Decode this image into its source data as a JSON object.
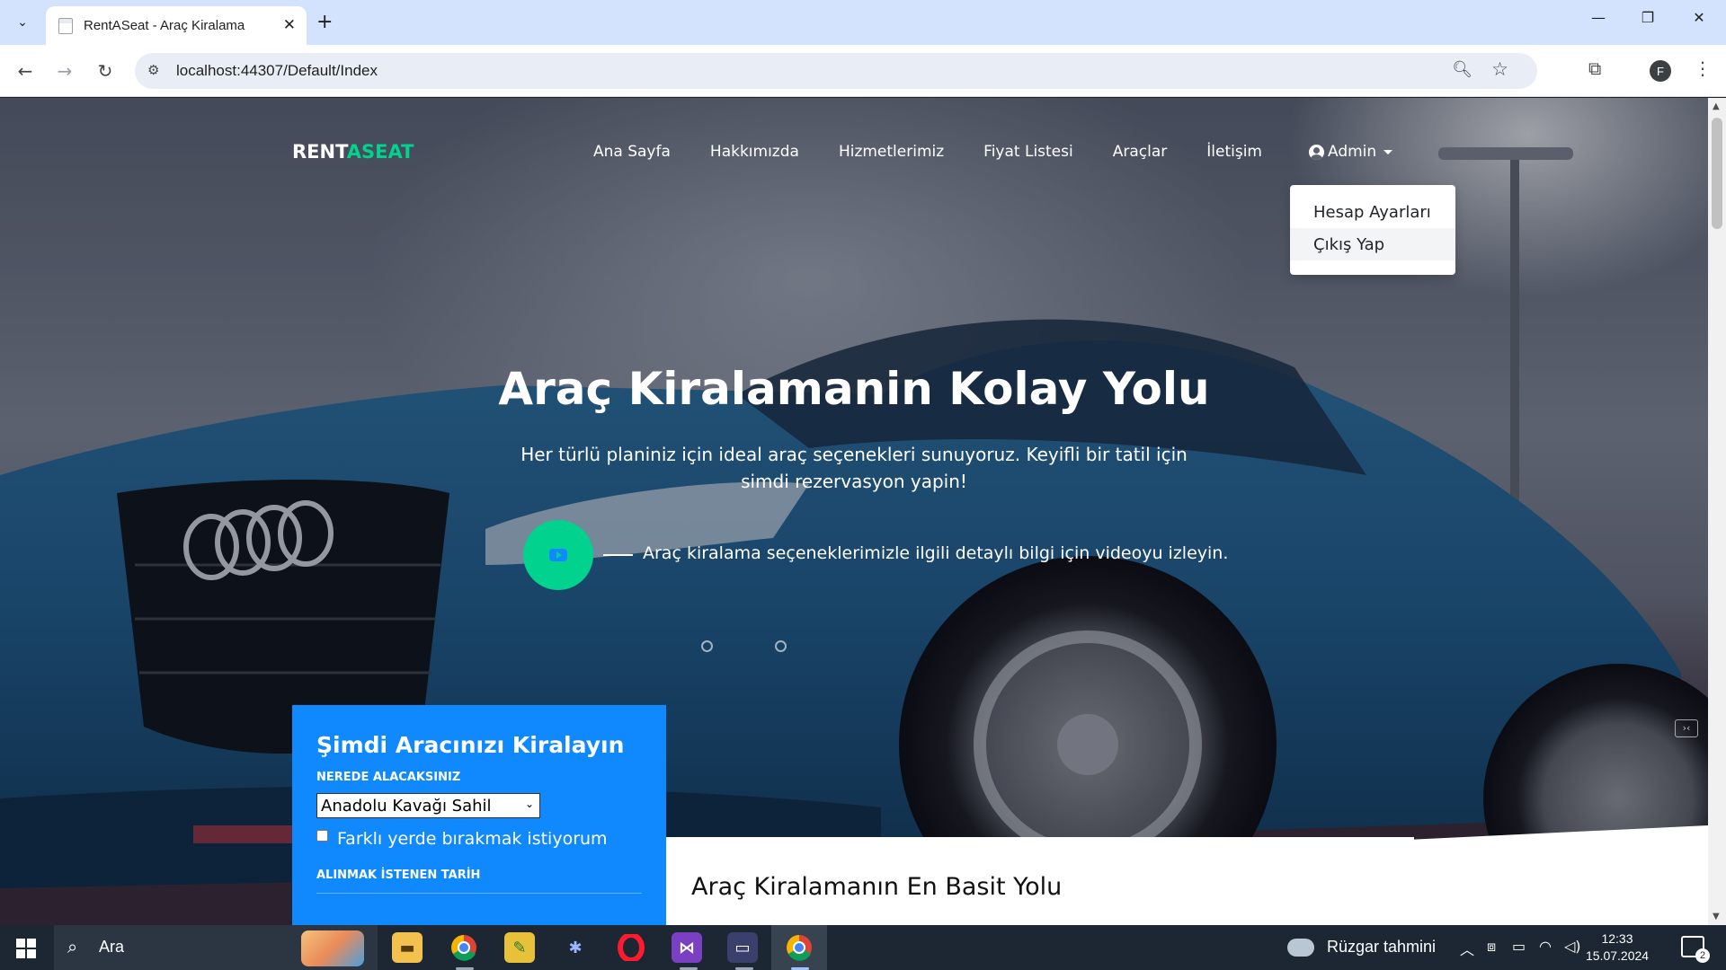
{
  "browser": {
    "tab_title": "RentASeat - Araç Kiralama",
    "url": "localhost:44307/Default/Index",
    "profile_initial": "F"
  },
  "site": {
    "brand_main": "RENT",
    "brand_accent": "ASEAT",
    "nav": [
      {
        "label": "Ana Sayfa"
      },
      {
        "label": "Hakkımızda"
      },
      {
        "label": "Hizmetlerimiz"
      },
      {
        "label": "Fiyat Listesi"
      },
      {
        "label": "Araçlar"
      },
      {
        "label": "İletişim"
      }
    ],
    "admin_label": "Admin",
    "dropdown": [
      {
        "label": "Hesap Ayarları"
      },
      {
        "label": "Çıkış Yap"
      }
    ]
  },
  "hero": {
    "title": "Araç Kiralamanin Kolay Yolu",
    "subtitle": "Her türlü planiniz için ideal araç seçenekleri sunuyoruz. Keyifli bir tatil için simdi rezervasyon yapin!",
    "video_text": "Araç kiralama seçeneklerimizle ilgili detaylı bilgi için videoyu izleyin."
  },
  "booking": {
    "title": "Şimdi Aracınızı Kiralayın",
    "pickup_label": "NEREDE ALACAKSINIZ",
    "pickup_selected": "Anadolu Kavağı Sahil",
    "different_dropoff_label": "Farklı yerde bırakmak istiyorum",
    "date_label": "ALINMAK İSTENEN TARİH"
  },
  "section": {
    "title": "Araç Kiralamanın En Basit Yolu"
  },
  "taskbar": {
    "search_text": "Ara",
    "weather": "Rüzgar tahmini",
    "time": "12:33",
    "date": "15.07.2024",
    "notification_count": "2"
  },
  "colors": {
    "accent_green": "#01d28e",
    "accent_blue": "#1089ff"
  }
}
